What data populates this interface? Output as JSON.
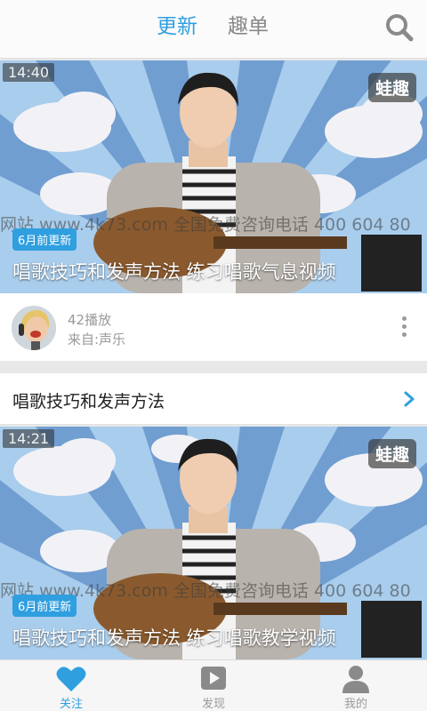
{
  "header": {
    "tabs": [
      {
        "label": "更新",
        "active": true
      },
      {
        "label": "趣单",
        "active": false
      }
    ],
    "search_icon": "search-icon"
  },
  "videos": [
    {
      "duration": "14:40",
      "brand": "蛙趣",
      "watermark": "网站 www.4k73.com 全国免费咨询电话 400 604 80",
      "updated": "6月前更新",
      "title": "唱歌技巧和发声方法 练习唱歌气息视频"
    },
    {
      "duration": "14:21",
      "brand": "蛙趣",
      "watermark": "网站 www.4k73.com 全国免费咨询电话 400 604 80",
      "updated": "6月前更新",
      "title": "唱歌技巧和发声方法 练习唱歌教学视频"
    }
  ],
  "meta": {
    "plays": "42播放",
    "source": "来自:声乐"
  },
  "section": {
    "title": "唱歌技巧和发声方法"
  },
  "bottom_nav": [
    {
      "label": "关注",
      "icon": "heart-icon",
      "active": true
    },
    {
      "label": "发现",
      "icon": "play-icon",
      "active": false
    },
    {
      "label": "我的",
      "icon": "person-icon",
      "active": false
    }
  ],
  "colors": {
    "accent": "#2f9fe0",
    "inactive": "#999999"
  }
}
